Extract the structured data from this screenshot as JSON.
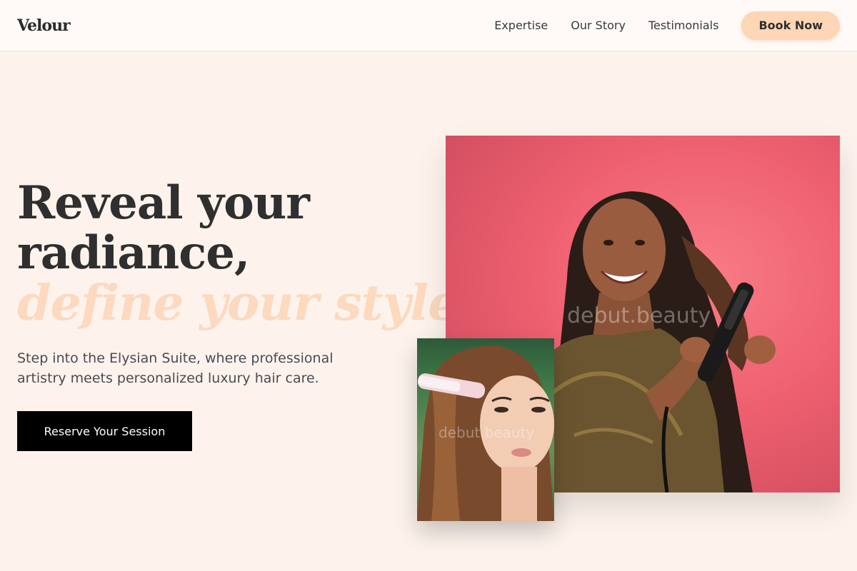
{
  "brand": {
    "logo": "Velour"
  },
  "nav": {
    "links": [
      "Expertise",
      "Our Story",
      "Testimonials"
    ],
    "book_label": "Book Now"
  },
  "hero": {
    "headline_line1": "Reveal your",
    "headline_line2": "radiance,",
    "headline_accent": "define your style.",
    "subtext": "Step into the Elysian Suite, where professional artistry meets personalized luxury hair care.",
    "cta_label": "Reserve Your Session"
  },
  "images": {
    "main_watermark": "debut.beauty",
    "inset_watermark": "debut.beauty"
  },
  "colors": {
    "background": "#fdf3ec",
    "accent_peach": "#fdd6b6",
    "headline_accent": "#fcd9bf",
    "cta_background": "#000000",
    "photo_backdrop": "#ee6070"
  },
  "icons": []
}
